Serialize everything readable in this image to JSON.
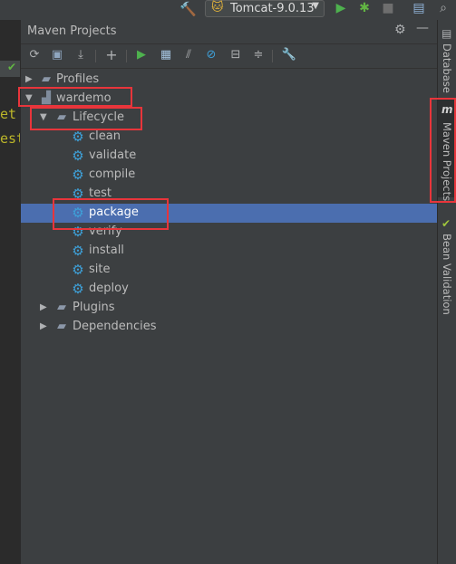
{
  "top_bar": {
    "run_config": "Tomcat-9.0.13",
    "icons": [
      "hammer-icon",
      "tomcat-icon",
      "run-icon",
      "debug-icon",
      "stop-icon",
      "project-structure-icon",
      "search-icon"
    ]
  },
  "editor": {
    "code_fragments": [
      "et",
      "est"
    ]
  },
  "panel": {
    "title": "Maven Projects",
    "header_icons": [
      "settings-icon",
      "minimize-icon"
    ],
    "toolbar_icons": [
      "reimport-icon",
      "generate-sources-icon",
      "download-icon",
      "add-icon",
      "run-icon",
      "execute-goal-icon",
      "toggle-offline-icon",
      "skip-tests-icon",
      "show-dependencies-icon",
      "collapse-icon",
      "settings-wrench-icon"
    ]
  },
  "tree": {
    "profiles": "Profiles",
    "project": "wardemo",
    "lifecycle": "Lifecycle",
    "goals": [
      "clean",
      "validate",
      "compile",
      "test",
      "package",
      "verify",
      "install",
      "site",
      "deploy"
    ],
    "selected_goal": "package",
    "plugins": "Plugins",
    "dependencies": "Dependencies"
  },
  "right_strip": {
    "tabs": [
      "Database",
      "Maven Projects",
      "Bean Validation"
    ],
    "maven_icon": "m",
    "active_tab": "Maven Projects"
  },
  "colors": {
    "selection": "#4b6eaf",
    "highlight_box": "#e8353b",
    "goal_gear": "#3ea0d8"
  }
}
